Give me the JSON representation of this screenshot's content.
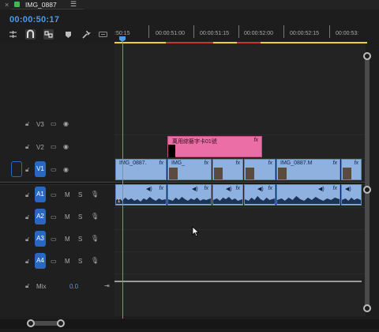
{
  "window": {
    "title": "IMG_0887",
    "close_glyph": "×",
    "menu_glyph": "☰"
  },
  "timecode": "00:00:50:17",
  "toolbar": {
    "tools": [
      "snap-icon",
      "magnet-icon",
      "linked-select-icon",
      "marker-icon",
      "wrench-icon",
      "captions-icon"
    ]
  },
  "ruler": {
    "labels": [
      ":50:15",
      "00:00:51:00",
      "00:00:51:15",
      "00:00:52:00",
      "00:00:52:15",
      "00:00:53:"
    ]
  },
  "tracks": {
    "video": [
      {
        "name": "V3"
      },
      {
        "name": "V2"
      },
      {
        "name": "V1",
        "source": "V1"
      }
    ],
    "audio": [
      {
        "name": "A1",
        "source": "A1",
        "m": "M",
        "s": "S"
      },
      {
        "name": "A2",
        "m": "M",
        "s": "S"
      },
      {
        "name": "A3",
        "m": "M",
        "s": "S"
      },
      {
        "name": "A4",
        "m": "M",
        "s": "S"
      }
    ],
    "mix": {
      "label": "Mix",
      "value": "0.0"
    }
  },
  "clips": {
    "title": {
      "label": "萬用綜藝字卡01號",
      "fx": "fx"
    },
    "video": [
      {
        "label": "IMG_0887.",
        "fx": "fx"
      },
      {
        "label": "IMG_",
        "fx": "fx"
      },
      {
        "label": "",
        "fx": "fx"
      },
      {
        "label": "",
        "fx": "fx"
      },
      {
        "label": "IMG_0887.M",
        "fx": "fx"
      },
      {
        "label": "",
        "fx": "fx"
      }
    ],
    "audio_fx": "fx",
    "audio_index": "1"
  },
  "colors": {
    "accent": "#4c9be8",
    "video_clip": "#8fb1e0",
    "title_clip": "#eb6fa6",
    "track_badge": "#2a67c3",
    "ruler_bar": "#e8d62a"
  }
}
